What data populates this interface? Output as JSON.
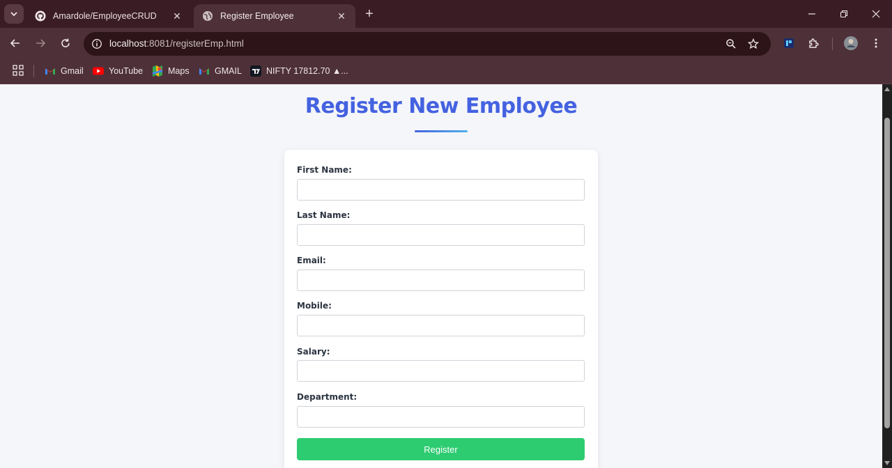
{
  "browser": {
    "tabs": [
      {
        "title": "Amardole/EmployeeCRUD",
        "icon": "github-icon"
      },
      {
        "title": "Register Employee",
        "icon": "globe-icon"
      }
    ],
    "url_host": "localhost",
    "url_path": ":8081/registerEmp.html",
    "bookmarks": [
      {
        "label": "Gmail",
        "icon": "gmail-icon"
      },
      {
        "label": "YouTube",
        "icon": "youtube-icon"
      },
      {
        "label": "Maps",
        "icon": "maps-icon"
      },
      {
        "label": "GMAIL",
        "icon": "gmail-icon"
      },
      {
        "label": "NIFTY 17812.70 ▲...",
        "icon": "tradingview-icon"
      }
    ]
  },
  "page": {
    "title": "Register New Employee",
    "accent_color": "#4462e0",
    "button_color": "#2ecc71",
    "fields": [
      {
        "label": "First Name:",
        "value": ""
      },
      {
        "label": "Last Name:",
        "value": ""
      },
      {
        "label": "Email:",
        "value": ""
      },
      {
        "label": "Mobile:",
        "value": ""
      },
      {
        "label": "Salary:",
        "value": ""
      },
      {
        "label": "Department:",
        "value": ""
      }
    ],
    "submit_label": "Register"
  }
}
